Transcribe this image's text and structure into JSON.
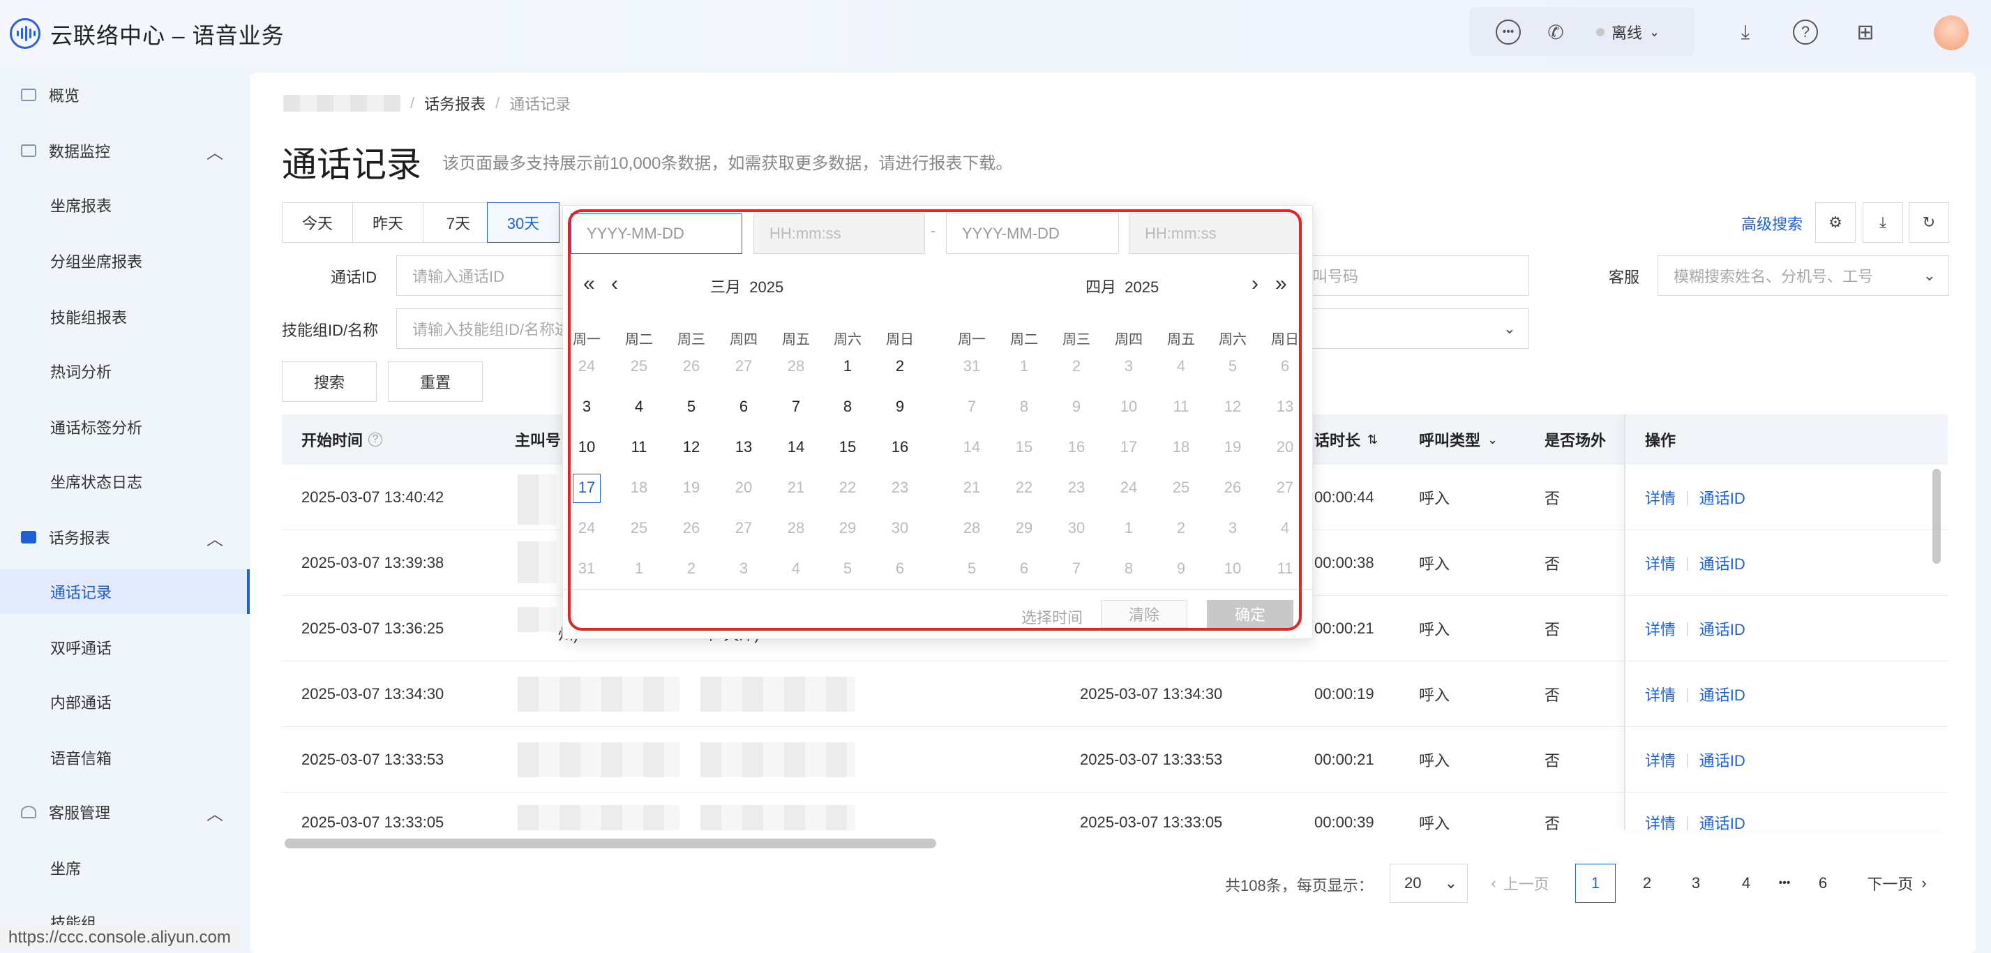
{
  "app": {
    "title": "云联络中心 – 语音业务"
  },
  "topbar": {
    "status_label": "离线",
    "icons": [
      "chat-icon",
      "phone-icon",
      "download-icon",
      "help-icon",
      "apps-icon"
    ]
  },
  "sidebar": {
    "items": [
      {
        "label": "概览",
        "type": "group"
      },
      {
        "label": "数据监控",
        "type": "group",
        "expanded": true
      },
      {
        "label": "坐席报表",
        "type": "sub"
      },
      {
        "label": "分组坐席报表",
        "type": "sub"
      },
      {
        "label": "技能组报表",
        "type": "sub"
      },
      {
        "label": "热词分析",
        "type": "sub"
      },
      {
        "label": "通话标签分析",
        "type": "sub"
      },
      {
        "label": "坐席状态日志",
        "type": "sub"
      },
      {
        "label": "话务报表",
        "type": "group",
        "expanded": true
      },
      {
        "label": "通话记录",
        "type": "sub",
        "active": true
      },
      {
        "label": "双呼通话",
        "type": "sub"
      },
      {
        "label": "内部通话",
        "type": "sub"
      },
      {
        "label": "语音信箱",
        "type": "sub"
      },
      {
        "label": "客服管理",
        "type": "group",
        "expanded": true
      },
      {
        "label": "坐席",
        "type": "sub"
      },
      {
        "label": "技能组",
        "type": "sub"
      }
    ],
    "url_hint": "https://ccc.console.aliyun.com"
  },
  "breadcrumb": {
    "parent": "话务报表",
    "current": "通话记录"
  },
  "page": {
    "title": "通话记录",
    "description": "该页面最多支持展示前10,000条数据，如需获取更多数据，请进行报表下载。"
  },
  "range_tabs": [
    "今天",
    "昨天",
    "7天",
    "30天"
  ],
  "range_selected": "30天",
  "toolbar": {
    "advanced_search": "高级搜索"
  },
  "filters": {
    "call_id_label": "通话ID",
    "call_id_placeholder": "请输入通话ID",
    "callee_placeholder": "叫号码",
    "agent_label": "客服",
    "agent_placeholder": "模糊搜索姓名、分机号、工号",
    "skill_label": "技能组ID/名称",
    "skill_placeholder": "请输入技能组ID/名称进行搜索",
    "search_button": "搜索",
    "reset_button": "重置"
  },
  "table": {
    "headers": {
      "start_time": "开始时间",
      "caller": "主叫号",
      "duration": "话时长",
      "call_type": "呼叫类型",
      "outside": "是否场外",
      "operation": "操作"
    },
    "rows": [
      {
        "start_time": "2025-03-07 13:40:42",
        "caller_partial": "",
        "callee_partial": "",
        "answer_time": "",
        "duration": "00:00:44",
        "call_type": "呼入",
        "outside": "否"
      },
      {
        "start_time": "2025-03-07 13:39:38",
        "caller_partial": "",
        "callee_partial": "",
        "answer_time": "",
        "duration": "00:00:38",
        "call_type": "呼入",
        "outside": "否"
      },
      {
        "start_time": "2025-03-07 13:36:25",
        "caller_partial": "州)",
        "callee_partial": "市-天津)",
        "answer_time": "",
        "duration": "00:00:21",
        "call_type": "呼入",
        "outside": "否"
      },
      {
        "start_time": "2025-03-07 13:34:30",
        "caller_partial": "",
        "callee_partial": "",
        "answer_time": "2025-03-07 13:34:30",
        "duration": "00:00:19",
        "call_type": "呼入",
        "outside": "否"
      },
      {
        "start_time": "2025-03-07 13:33:53",
        "caller_partial": "",
        "callee_partial": "",
        "answer_time": "2025-03-07 13:33:53",
        "duration": "00:00:21",
        "call_type": "呼入",
        "outside": "否"
      },
      {
        "start_time": "2025-03-07 13:33:05",
        "caller_partial": "",
        "callee_partial": "",
        "answer_time": "2025-03-07 13:33:05",
        "duration": "00:00:39",
        "call_type": "呼入",
        "outside": "否"
      }
    ],
    "op_detail": "详情",
    "op_callid": "通话ID"
  },
  "pagination": {
    "total_text": "共108条，每页显示：",
    "page_size": "20",
    "prev": "上一页",
    "next": "下一页",
    "pages": [
      "1",
      "2",
      "3",
      "4",
      "6"
    ],
    "ellipsis": "•••",
    "current": "1"
  },
  "datepicker": {
    "start_date_placeholder": "YYYY-MM-DD",
    "start_time_placeholder": "HH:mm:ss",
    "end_date_placeholder": "YYYY-MM-DD",
    "end_time_placeholder": "HH:mm:ss",
    "separator": "-",
    "left_month": "三月",
    "left_year": "2025",
    "right_month": "四月",
    "right_year": "2025",
    "weekdays": [
      "周一",
      "周二",
      "周三",
      "周四",
      "周五",
      "周六",
      "周日"
    ],
    "left_days": [
      [
        "24",
        "o"
      ],
      [
        "25",
        "o"
      ],
      [
        "26",
        "o"
      ],
      [
        "27",
        "o"
      ],
      [
        "28",
        "o"
      ],
      [
        "1",
        "c"
      ],
      [
        "2",
        "c"
      ],
      [
        "3",
        "c"
      ],
      [
        "4",
        "c"
      ],
      [
        "5",
        "c"
      ],
      [
        "6",
        "c"
      ],
      [
        "7",
        "c"
      ],
      [
        "8",
        "c"
      ],
      [
        "9",
        "c"
      ],
      [
        "10",
        "c"
      ],
      [
        "11",
        "c"
      ],
      [
        "12",
        "c"
      ],
      [
        "13",
        "c"
      ],
      [
        "14",
        "c"
      ],
      [
        "15",
        "c"
      ],
      [
        "16",
        "c"
      ],
      [
        "17",
        "t"
      ],
      [
        "18",
        "o"
      ],
      [
        "19",
        "o"
      ],
      [
        "20",
        "o"
      ],
      [
        "21",
        "o"
      ],
      [
        "22",
        "o"
      ],
      [
        "23",
        "o"
      ],
      [
        "24",
        "o"
      ],
      [
        "25",
        "o"
      ],
      [
        "26",
        "o"
      ],
      [
        "27",
        "o"
      ],
      [
        "28",
        "o"
      ],
      [
        "29",
        "o"
      ],
      [
        "30",
        "o"
      ],
      [
        "31",
        "o"
      ],
      [
        "1",
        "o"
      ],
      [
        "2",
        "o"
      ],
      [
        "3",
        "o"
      ],
      [
        "4",
        "o"
      ],
      [
        "5",
        "o"
      ],
      [
        "6",
        "o"
      ]
    ],
    "right_days": [
      "31",
      "1",
      "2",
      "3",
      "4",
      "5",
      "6",
      "7",
      "8",
      "9",
      "10",
      "11",
      "12",
      "13",
      "14",
      "15",
      "16",
      "17",
      "18",
      "19",
      "20",
      "21",
      "22",
      "23",
      "24",
      "25",
      "26",
      "27",
      "28",
      "29",
      "30",
      "1",
      "2",
      "3",
      "4",
      "5",
      "6",
      "7",
      "8",
      "9",
      "10",
      "11"
    ],
    "footer_select_time": "选择时间",
    "footer_clear": "清除",
    "footer_confirm": "确定"
  }
}
